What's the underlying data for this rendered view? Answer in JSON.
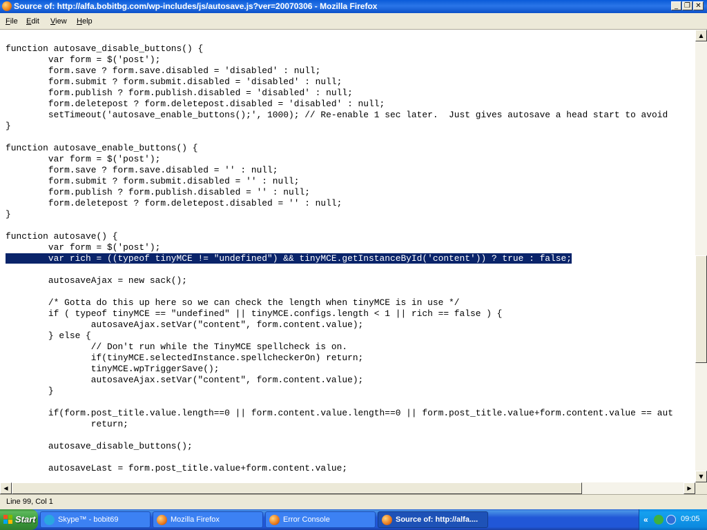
{
  "window": {
    "title": "Source of: http://alfa.bobitbg.com/wp-includes/js/autosave.js?ver=20070306 - Mozilla Firefox",
    "controls": [
      "_",
      "❐",
      "✕"
    ]
  },
  "menu": [
    "File",
    "Edit",
    "View",
    "Help"
  ],
  "code_lines": [
    "function autosave_disable_buttons() {",
    "        var form = $('post');",
    "        form.save ? form.save.disabled = 'disabled' : null;",
    "        form.submit ? form.submit.disabled = 'disabled' : null;",
    "        form.publish ? form.publish.disabled = 'disabled' : null;",
    "        form.deletepost ? form.deletepost.disabled = 'disabled' : null;",
    "        setTimeout('autosave_enable_buttons();', 1000); // Re-enable 1 sec later.  Just gives autosave a head start to avoid",
    "}",
    "",
    "function autosave_enable_buttons() {",
    "        var form = $('post');",
    "        form.save ? form.save.disabled = '' : null;",
    "        form.submit ? form.submit.disabled = '' : null;",
    "        form.publish ? form.publish.disabled = '' : null;",
    "        form.deletepost ? form.deletepost.disabled = '' : null;",
    "}",
    "",
    "function autosave() {",
    "        var form = $('post');",
    "        var rich = ((typeof tinyMCE != \"undefined\") && tinyMCE.getInstanceById('content')) ? true : false;",
    "",
    "        autosaveAjax = new sack();",
    "",
    "        /* Gotta do this up here so we can check the length when tinyMCE is in use */",
    "        if ( typeof tinyMCE == \"undefined\" || tinyMCE.configs.length < 1 || rich == false ) {",
    "                autosaveAjax.setVar(\"content\", form.content.value);",
    "        } else {",
    "                // Don't run while the TinyMCE spellcheck is on.",
    "                if(tinyMCE.selectedInstance.spellcheckerOn) return;",
    "                tinyMCE.wpTriggerSave();",
    "                autosaveAjax.setVar(\"content\", form.content.value);",
    "        }",
    "",
    "        if(form.post_title.value.length==0 || form.content.value.length==0 || form.post_title.value+form.content.value == aut",
    "                return;",
    "",
    "        autosave_disable_buttons();",
    "",
    "        autosaveLast = form.post_title.value+form.content.value;"
  ],
  "selected_line": 19,
  "status": "Line 99, Col 1",
  "taskbar": {
    "start": "Start",
    "tasks": [
      {
        "label": "Skype™ - bobit69",
        "icon": "skype-icon",
        "color": "#2aa7e0"
      },
      {
        "label": "Mozilla Firefox",
        "icon": "firefox-icon",
        "color": "#e8791c"
      },
      {
        "label": "Error Console",
        "icon": "firefox-icon",
        "color": "#e8791c"
      },
      {
        "label": "Source of: http://alfa....",
        "icon": "firefox-icon",
        "color": "#e8791c",
        "active": true
      }
    ],
    "tray_chevron": "«",
    "clock": "09:05"
  }
}
